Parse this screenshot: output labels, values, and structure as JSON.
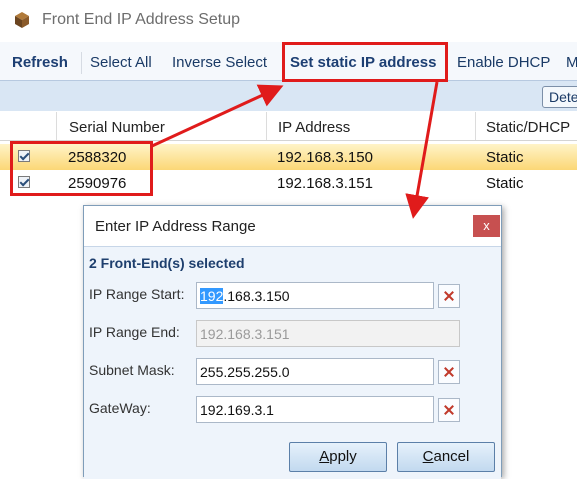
{
  "window": {
    "title": "Front End IP Address Setup",
    "icon": "app-box-icon"
  },
  "toolbar": {
    "refresh": "Refresh",
    "select_all": "Select All",
    "inverse_select": "Inverse Select",
    "set_static": "Set static IP address",
    "enable_dhcp": "Enable DHCP",
    "more": "M"
  },
  "strip": {
    "det_button": "Dete"
  },
  "grid": {
    "headers": {
      "serial": "Serial Number",
      "ip": "IP Address",
      "mode": "Static/DHCP"
    },
    "rows": [
      {
        "checked": true,
        "serial": "2588320",
        "ip": "192.168.3.150",
        "mode": "Static",
        "selected": true
      },
      {
        "checked": true,
        "serial": "2590976",
        "ip": "192.168.3.151",
        "mode": "Static",
        "selected": false
      }
    ]
  },
  "dialog": {
    "title": "Enter IP Address Range",
    "close": "x",
    "selection_summary": "2 Front-End(s) selected",
    "fields": {
      "range_start": {
        "label": "IP Range Start:",
        "value_highlight": "192",
        "value_rest": ".168.3.150"
      },
      "range_end": {
        "label": "IP Range End:",
        "value": "192.168.3.151"
      },
      "subnet": {
        "label": "Subnet Mask:",
        "value": "255.255.255.0"
      },
      "gateway": {
        "label": "GateWay:",
        "value": "192.169.3.1"
      }
    },
    "buttons": {
      "apply": {
        "mnemonic": "A",
        "rest": "pply"
      },
      "cancel": {
        "mnemonic": "C",
        "rest": "ancel"
      }
    }
  },
  "colors": {
    "annotation_red": "#e01b1b",
    "selected_row": "#fbd776",
    "title_close": "#c75050"
  }
}
